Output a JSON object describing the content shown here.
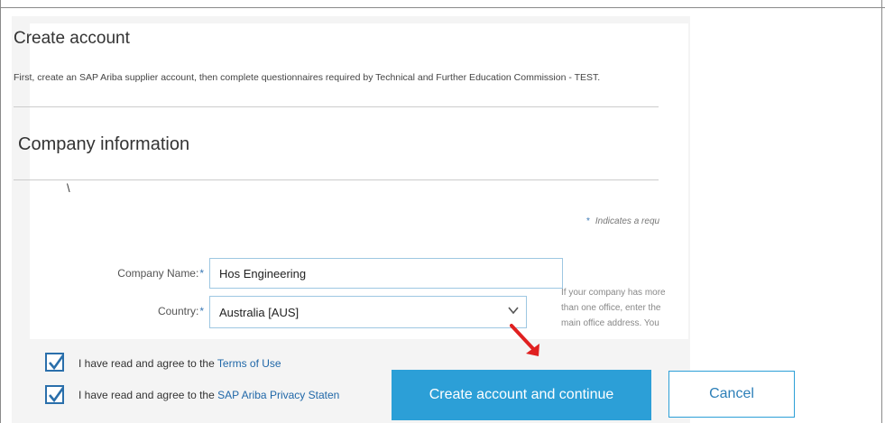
{
  "page": {
    "title": "Create account",
    "subtitle": "First, create an SAP Ariba supplier account, then complete questionnaires required by Technical and Further Education Commission - TEST.",
    "section_title": "Company information",
    "stray_char": "\\",
    "required_note": "Indicates a requ",
    "required_star": "*"
  },
  "form": {
    "company_name_label": "Company Name:",
    "company_name_value": "Hos Engineering",
    "country_label": "Country:",
    "country_value": "Australia  [AUS]",
    "required_star": "*",
    "hint": "If your company has more than one office, enter the main office address. You can enter"
  },
  "agreements": {
    "terms_prefix": "I have read and agree to the ",
    "terms_link": "Terms of Use",
    "privacy_prefix": "I have read and agree to the ",
    "privacy_link": "SAP Ariba Privacy Staten",
    "terms_checked": true,
    "privacy_checked": true
  },
  "buttons": {
    "create": "Create account and continue",
    "cancel": "Cancel"
  },
  "icons": {
    "checkbox_check": "check-icon",
    "dropdown": "chevron-down-icon",
    "annotation": "red-arrow-icon"
  },
  "colors": {
    "primary": "#2c9fd7",
    "link": "#1f67a8",
    "checkbox": "#2a6fab",
    "arrow": "#e02020"
  }
}
